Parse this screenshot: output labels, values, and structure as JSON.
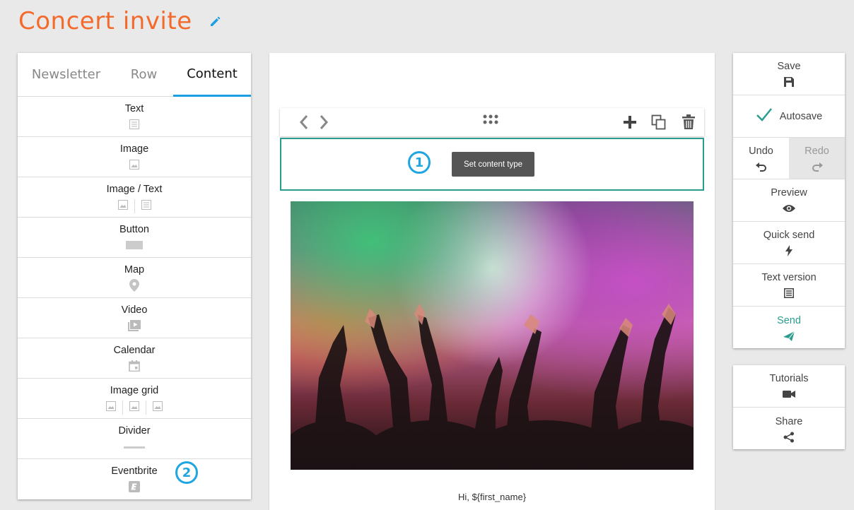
{
  "header": {
    "title": "Concert invite",
    "edit_icon": "pencil-icon"
  },
  "left_panel": {
    "tabs": [
      {
        "label": "Newsletter",
        "active": false
      },
      {
        "label": "Row",
        "active": false
      },
      {
        "label": "Content",
        "active": true
      }
    ],
    "blocks": [
      {
        "label": "Text",
        "icons": [
          "text-icon"
        ]
      },
      {
        "label": "Image",
        "icons": [
          "image-icon"
        ]
      },
      {
        "label": "Image / Text",
        "icons": [
          "image-icon",
          "text-icon"
        ]
      },
      {
        "label": "Button",
        "icons": [
          "button-icon"
        ]
      },
      {
        "label": "Map",
        "icons": [
          "map-pin-icon"
        ]
      },
      {
        "label": "Video",
        "icons": [
          "video-icon"
        ]
      },
      {
        "label": "Calendar",
        "icons": [
          "calendar-icon"
        ]
      },
      {
        "label": "Image grid",
        "icons": [
          "image-icon",
          "image-icon",
          "image-icon"
        ]
      },
      {
        "label": "Divider",
        "icons": [
          "divider-icon"
        ]
      },
      {
        "label": "Eventbrite",
        "icons": [
          "eventbrite-icon"
        ]
      }
    ],
    "step_badge": "2"
  },
  "canvas": {
    "toolbar_icons": [
      "chevron-left-icon",
      "chevron-right-icon",
      "drag-handle-icon",
      "add-icon",
      "copy-icon",
      "trash-icon"
    ],
    "step_badge": "1",
    "tooltip": "Set content type",
    "photo_alt": "concert-crowd-photo",
    "greeting": "Hi, ${first_name}"
  },
  "right_panel": {
    "save": "Save",
    "autosave": "Autosave",
    "undo": "Undo",
    "redo": "Redo",
    "preview": "Preview",
    "quick_send": "Quick send",
    "text_version": "Text version",
    "send": "Send",
    "tutorials": "Tutorials",
    "share": "Share"
  },
  "colors": {
    "accent": "#f36a2c",
    "teal": "#2a9d8f",
    "blue": "#1fa6e0"
  }
}
